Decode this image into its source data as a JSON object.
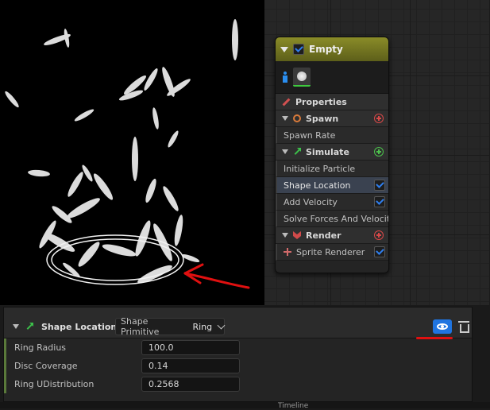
{
  "viewport": {
    "name": "particle-preview"
  },
  "emitter": {
    "title": "Empty",
    "properties_label": "Properties",
    "sections": [
      {
        "key": "spawn",
        "label": "Spawn",
        "items": [
          "Spawn Rate"
        ]
      },
      {
        "key": "simulate",
        "label": "Simulate",
        "items": [
          "Initialize Particle",
          "Shape Location",
          "Add Velocity",
          "Solve Forces And Velocity"
        ]
      },
      {
        "key": "render",
        "label": "Render",
        "items": [
          "Sprite Renderer"
        ]
      }
    ],
    "selected_item": "Shape Location"
  },
  "details": {
    "module_title": "Shape Location",
    "primitive_label": "Shape Primitive",
    "primitive_value": "Ring",
    "props": [
      {
        "label": "Ring Radius",
        "value": "100.0"
      },
      {
        "label": "Disc Coverage",
        "value": "0.14"
      },
      {
        "label": "Ring UDistribution",
        "value": "0.2568"
      }
    ]
  },
  "bottom": {
    "tab_label": "Timeline"
  },
  "colors": {
    "emitter_header": "#8a8c28",
    "eye_button": "#1f74e0",
    "annotation_red": "#e01010",
    "selected_row": "#3a4250"
  }
}
